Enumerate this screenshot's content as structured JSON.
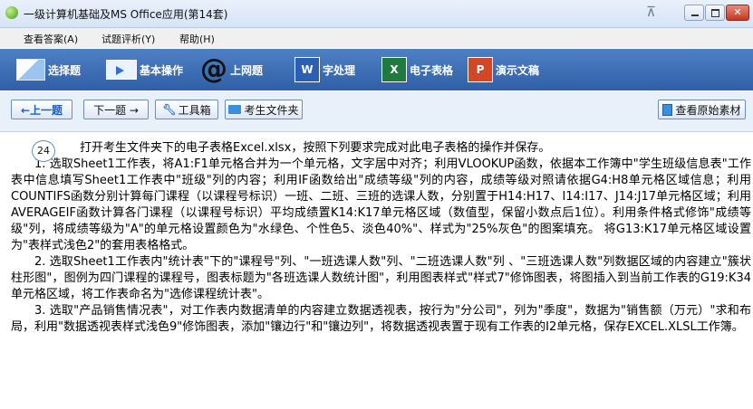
{
  "window": {
    "title": "一级计算机基础及MS Office应用(第14套)"
  },
  "menu": [
    {
      "label": "查看答案(A)"
    },
    {
      "label": "试题评析(Y)"
    },
    {
      "label": "帮助(H)"
    }
  ],
  "modules": [
    {
      "label": "选择题",
      "icon": "select-question-icon"
    },
    {
      "label": "基本操作",
      "icon": "basic-ops-icon"
    },
    {
      "label": "上网题",
      "icon": "at-sign-icon",
      "glyph": "@"
    },
    {
      "label": "字处理",
      "icon": "word-icon",
      "glyph": "W"
    },
    {
      "label": "电子表格",
      "icon": "excel-icon",
      "glyph": "X"
    },
    {
      "label": "演示文稿",
      "icon": "ppt-icon",
      "glyph": "P"
    }
  ],
  "nav": {
    "prev_label": "←上一题",
    "next_label": "下一题 →",
    "tools_label": "工具箱",
    "files_label": "考生文件夹",
    "source_label": "查看原始素材"
  },
  "question": {
    "number": "24",
    "intro": "打开考生文件夹下的电子表格Excel.xlsx，按照下列要求完成对此电子表格的操作并保存。",
    "items": [
      "1. 选取Sheet1工作表，将A1:F1单元格合并为一个单元格，文字居中对齐；利用VLOOKUP函数，依据本工作簿中\"学生班级信息表\"工作表中信息填写Sheet1工作表中\"班级\"列的内容；利用IF函数给出\"成绩等级\"列的内容，成绩等级对照请依据G4:H8单元格区域信息；利用COUNTIFS函数分别计算每门课程（以课程号标识）一班、二班、三班的选课人数，分别置于H14:H17、I14:I17、J14:J17单元格区域；利用AVERAGEIF函数计算各门课程（以课程号标识）平均成绩置K14:K17单元格区域（数值型，保留小数点后1位）。利用条件格式修饰\"成绩等级\"列，将成绩等级为\"A\"的单元格设置颜色为\"水绿色、个性色5、淡色40%\"、样式为\"25%灰色\"的图案填充。 将G13:K17单元格区域设置为\"表样式浅色2\"的套用表格格式。",
      "2. 选取Sheet1工作表内\"统计表\"下的\"课程号\"列、\"一班选课人数\"列、\"二班选课人数\"列 、\"三班选课人数\"列数据区域的内容建立\"簇状柱形图\"，图例为四门课程的课程号，图表标题为\"各班选课人数统计图\"，利用图表样式\"样式7\"修饰图表，将图插入到当前工作表的G19:K34单元格区域，将工作表命名为\"选修课程统计表\"。",
      "3. 选取\"产品销售情况表\"，对工作表内数据清单的内容建立数据透视表，按行为\"分公司\"，列为\"季度\"，数据为\"销售额（万元）\"求和布局，利用\"数据透视表样式浅色9\"修饰图表，添加\"镶边行\"和\"镶边列\"，将数据透视表置于现有工作表的I2单元格，保存EXCEL.XLSL工作簿。"
    ]
  }
}
